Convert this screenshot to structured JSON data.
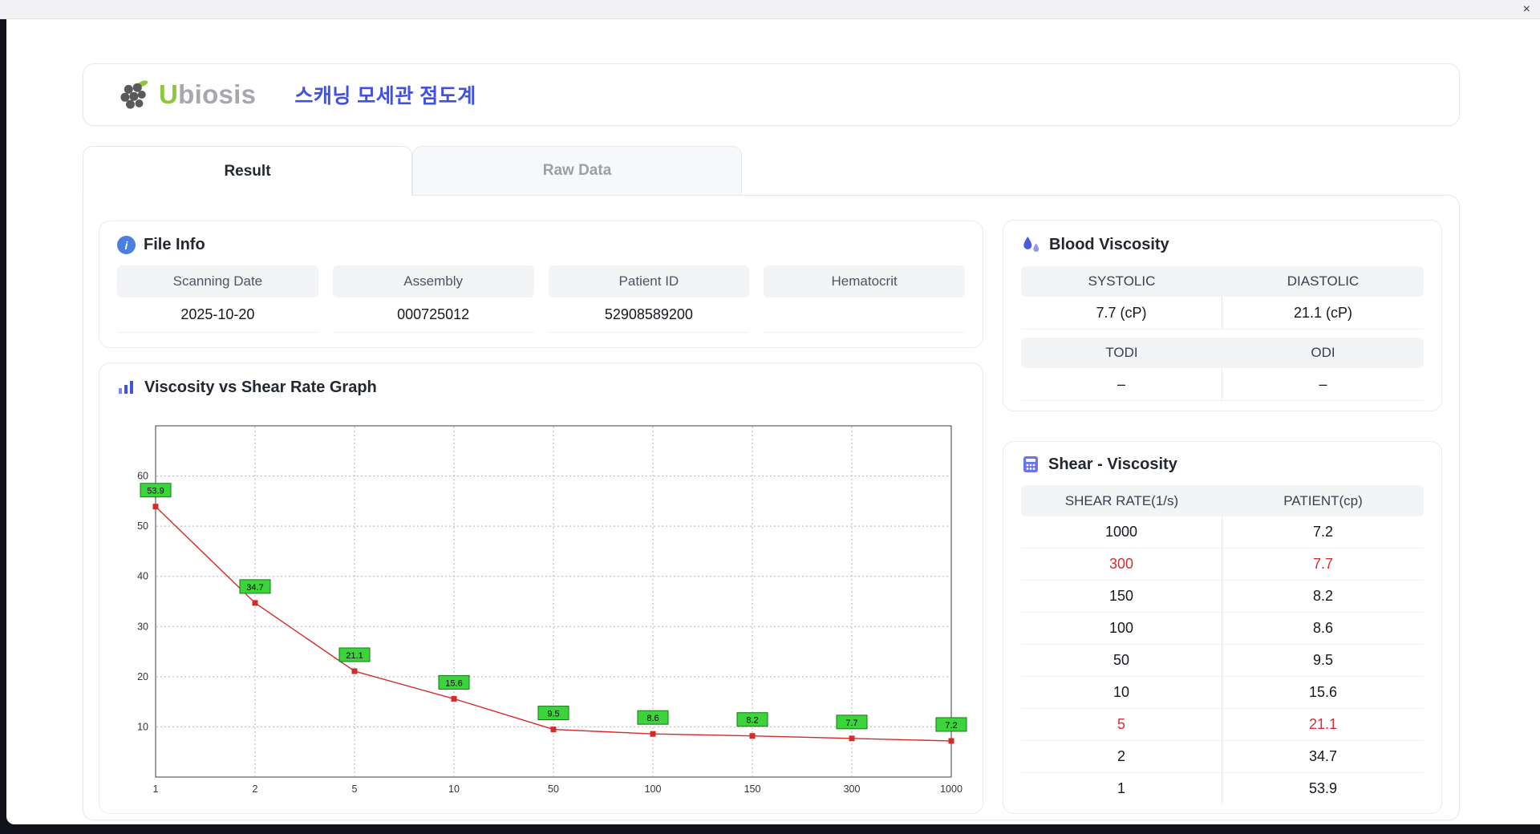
{
  "window": {
    "close": "×"
  },
  "header": {
    "logo_u": "U",
    "logo_rest": "biosis",
    "title": "스캐닝 모세관 점도계"
  },
  "tabs": [
    {
      "label": "Result",
      "active": true
    },
    {
      "label": "Raw Data",
      "active": false
    }
  ],
  "file_info": {
    "title": "File Info",
    "fields": [
      {
        "label": "Scanning Date",
        "value": "2025-10-20"
      },
      {
        "label": "Assembly",
        "value": "000725012"
      },
      {
        "label": "Patient ID",
        "value": "52908589200"
      },
      {
        "label": "Hematocrit",
        "value": ""
      }
    ]
  },
  "blood_viscosity": {
    "title": "Blood Viscosity",
    "rows": [
      {
        "labels": [
          "SYSTOLIC",
          "DIASTOLIC"
        ],
        "values": [
          "7.7 (cP)",
          "21.1 (cP)"
        ]
      },
      {
        "labels": [
          "TODI",
          "ODI"
        ],
        "values": [
          "–",
          "–"
        ]
      }
    ]
  },
  "graph": {
    "title": "Viscosity vs Shear Rate Graph"
  },
  "chart_data": {
    "type": "line",
    "title": "Viscosity vs Shear Rate Graph",
    "x": [
      1,
      2,
      5,
      10,
      50,
      100,
      150,
      300,
      1000
    ],
    "x_tick_labels": [
      "1",
      "2",
      "5",
      "10",
      "50",
      "100",
      "150",
      "300",
      "1000"
    ],
    "values": [
      53.9,
      34.7,
      21.1,
      15.6,
      9.5,
      8.6,
      8.2,
      7.7,
      7.2
    ],
    "y_ticks": [
      10,
      20,
      30,
      40,
      50,
      60
    ],
    "ylim": [
      0,
      70
    ],
    "x_axis_type": "categorical-equal-spacing",
    "grid": "dotted",
    "line_color": "#d42a2a",
    "marker_color": "#d42a2a",
    "label_bg": "#3bd43b",
    "xlabel": "",
    "ylabel": ""
  },
  "shear_viscosity": {
    "title": "Shear - Viscosity",
    "columns": [
      "SHEAR RATE(1/s)",
      "PATIENT(cp)"
    ],
    "rows": [
      {
        "shear": "1000",
        "patient": "7.2",
        "highlight": false
      },
      {
        "shear": "300",
        "patient": "7.7",
        "highlight": true
      },
      {
        "shear": "150",
        "patient": "8.2",
        "highlight": false
      },
      {
        "shear": "100",
        "patient": "8.6",
        "highlight": false
      },
      {
        "shear": "50",
        "patient": "9.5",
        "highlight": false
      },
      {
        "shear": "10",
        "patient": "15.6",
        "highlight": false
      },
      {
        "shear": "5",
        "patient": "21.1",
        "highlight": true
      },
      {
        "shear": "2",
        "patient": "34.7",
        "highlight": false
      },
      {
        "shear": "1",
        "patient": "53.9",
        "highlight": false
      }
    ]
  }
}
